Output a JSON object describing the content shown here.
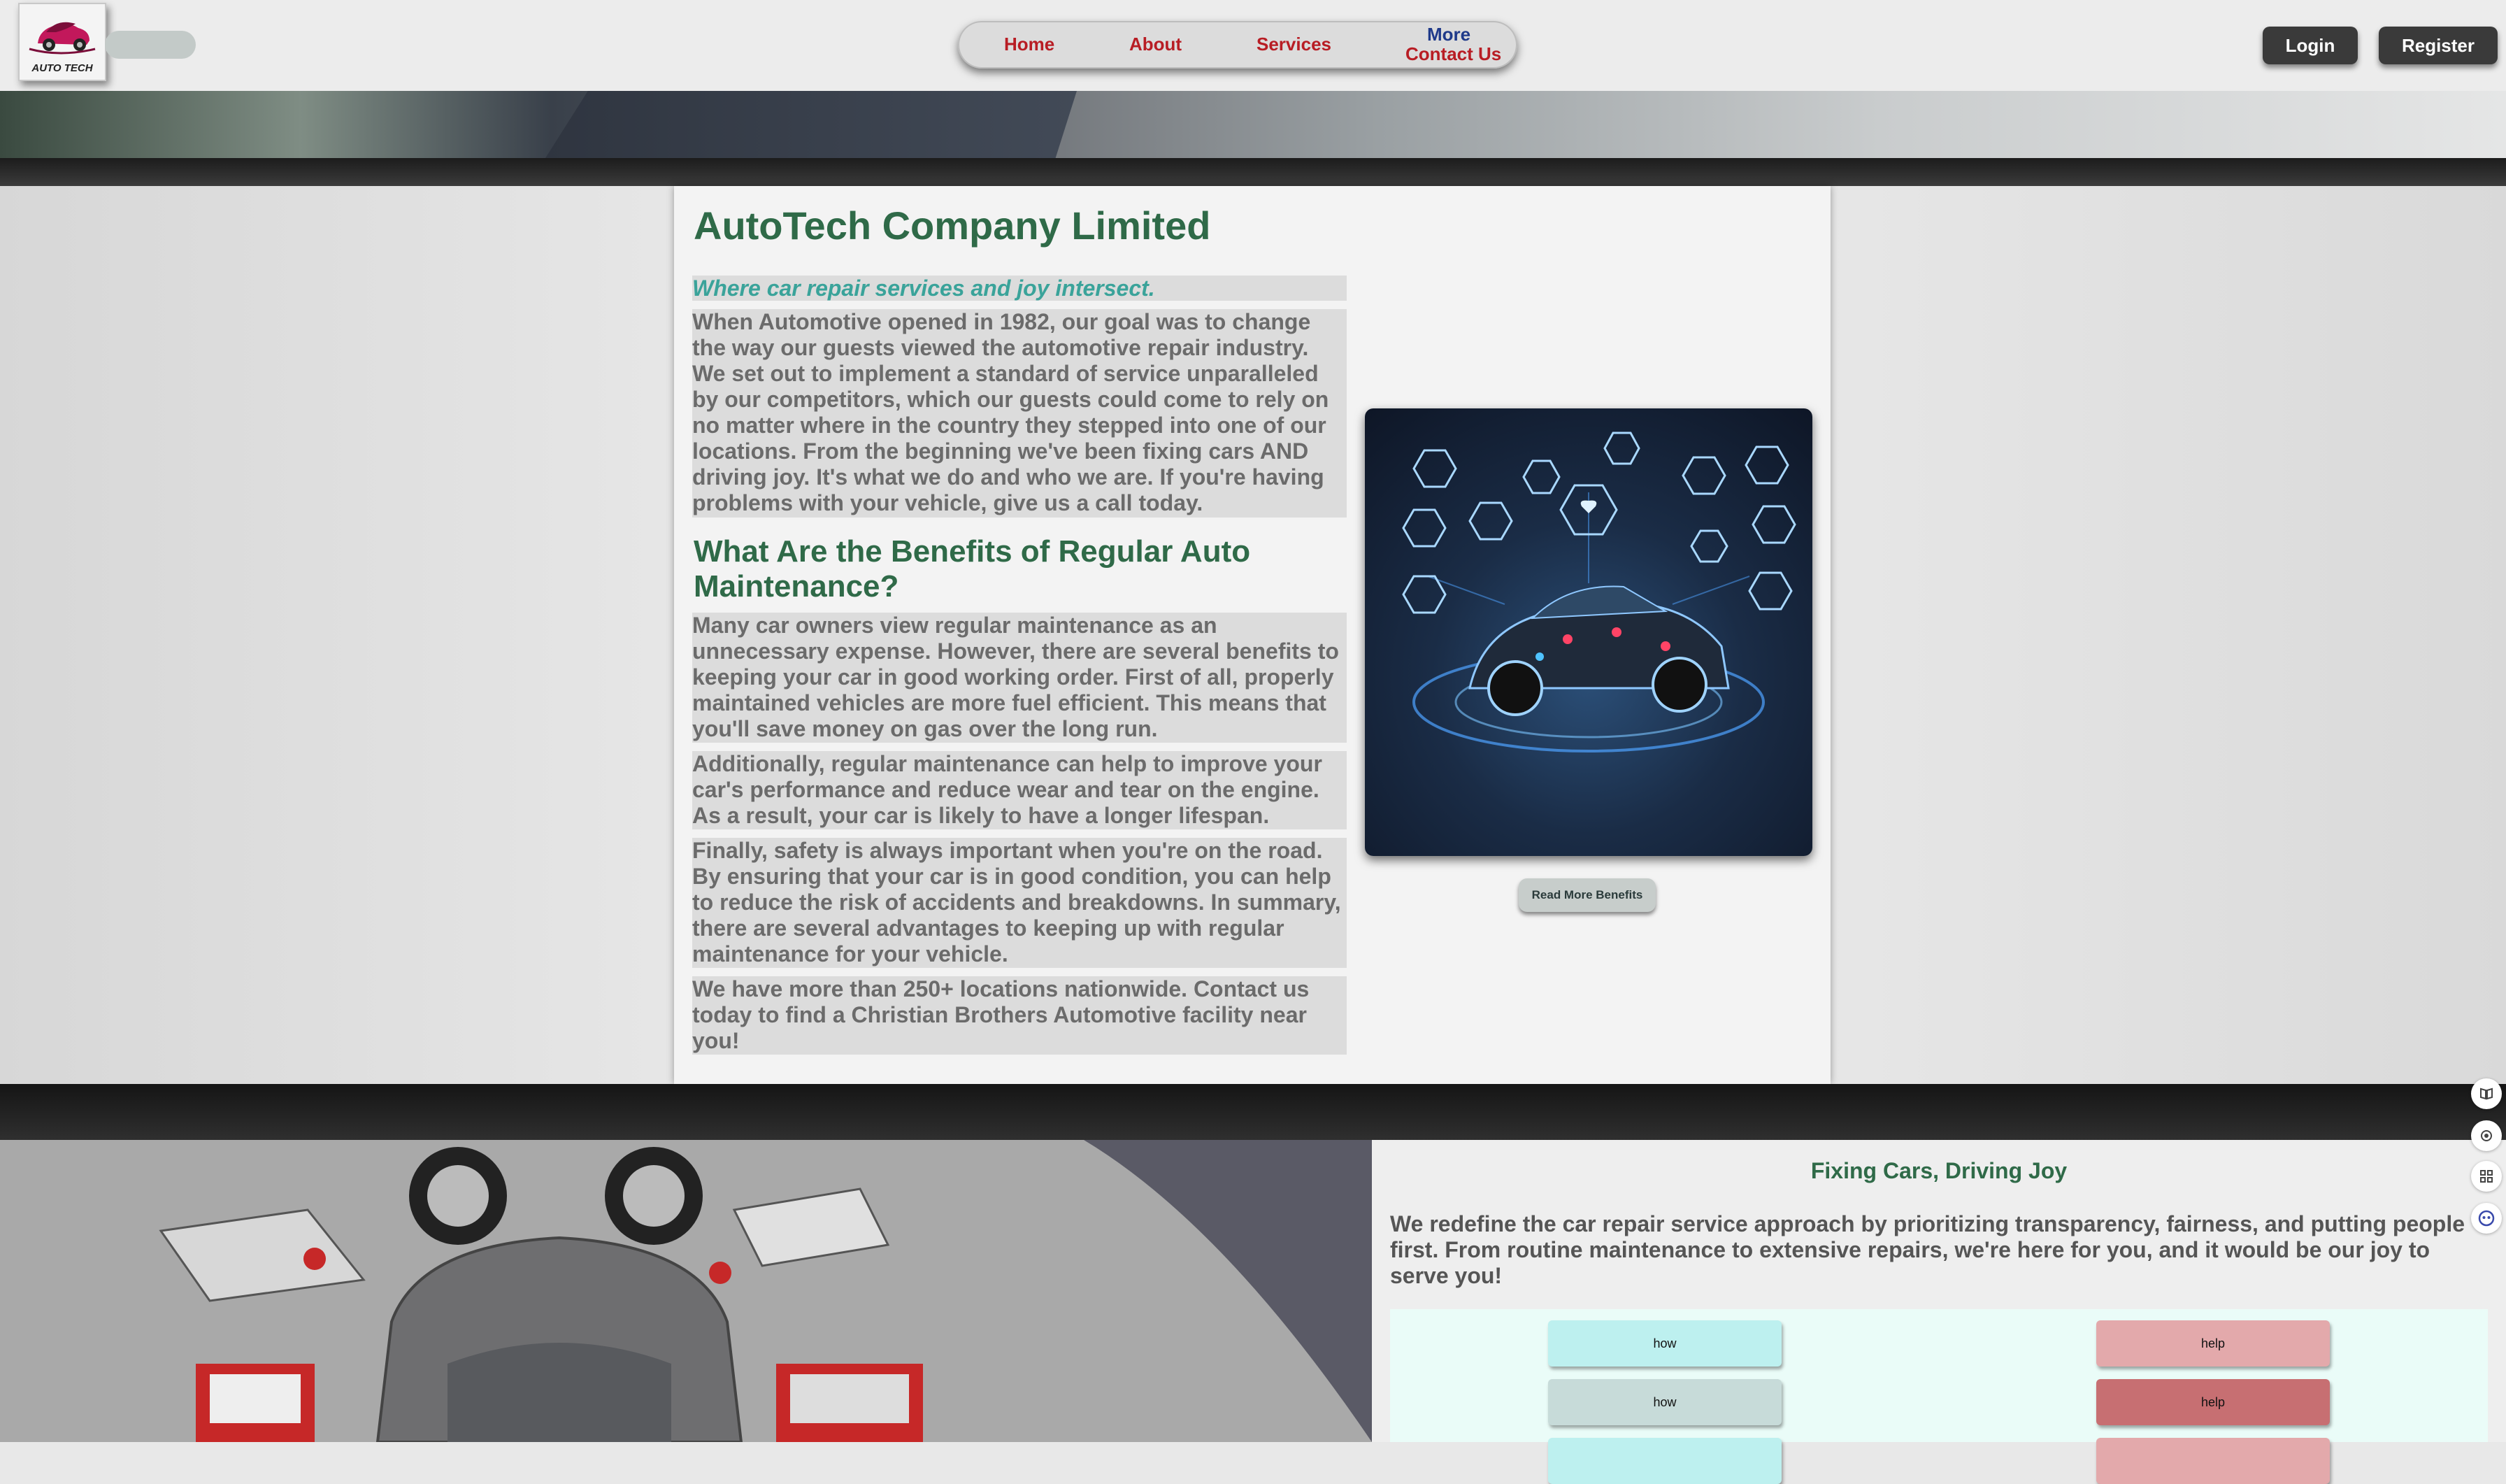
{
  "header": {
    "logo_text": "AUTO TECH",
    "nav": {
      "home": "Home",
      "about": "About",
      "services": "Services",
      "more": "More",
      "contact": "Contact Us"
    },
    "login": "Login",
    "register": "Register"
  },
  "main": {
    "title": "AutoTech Company Limited",
    "tagline": "Where car repair services and joy intersect.",
    "intro": "When Automotive opened in 1982, our goal was to change the way our guests viewed the automotive repair industry. We set out to implement a standard of service unparalleled by our competitors, which our guests could come to rely on no matter where in the country they stepped into one of our locations. From the beginning we've been fixing cars AND driving joy. It's what we do and who we are. If you're having problems with your vehicle, give us a call today.",
    "benefits_heading": "What Are the Benefits of Regular Auto Maintenance?",
    "benefits": [
      "Many car owners view regular maintenance as an unnecessary expense. However, there are several benefits to keeping your car in good working order. First of all, properly maintained vehicles are more fuel efficient. This means that you'll save money on gas over the long run.",
      "Additionally, regular maintenance can help to improve your car's performance and reduce wear and tear on the engine. As a result, your car is likely to have a longer lifespan.",
      "Finally, safety is always important when you're on the road. By ensuring that your car is in good condition, you can help to reduce the risk of accidents and breakdowns. In summary, there are several advantages to keeping up with regular maintenance for your vehicle.",
      "We have more than 250+ locations nationwide. Contact us today to find a Christian Brothers Automotive facility near you!"
    ],
    "read_more": "Read More Benefits"
  },
  "fixing": {
    "title": "Fixing Cars, Driving Joy",
    "text": "We redefine the car repair service approach by prioritizing transparency, fairness, and putting people first. From routine maintenance to extensive repairs, we're here for you, and it would be our joy to serve you!",
    "buttons": [
      {
        "label": "how",
        "color": "#bdf0ef"
      },
      {
        "label": "help",
        "color": "#e3a9ab"
      },
      {
        "label": "how",
        "color": "#c7dbd9"
      },
      {
        "label": "help",
        "color": "#c76f72"
      }
    ]
  },
  "side_icons": [
    "book-icon",
    "settings-icon",
    "grid-icon",
    "assistant-icon"
  ],
  "colors": {
    "accent_green": "#2f6a48",
    "nav_red": "#b81d24",
    "nav_blue": "#1f3a8a",
    "tagline_teal": "#3aa39a"
  }
}
